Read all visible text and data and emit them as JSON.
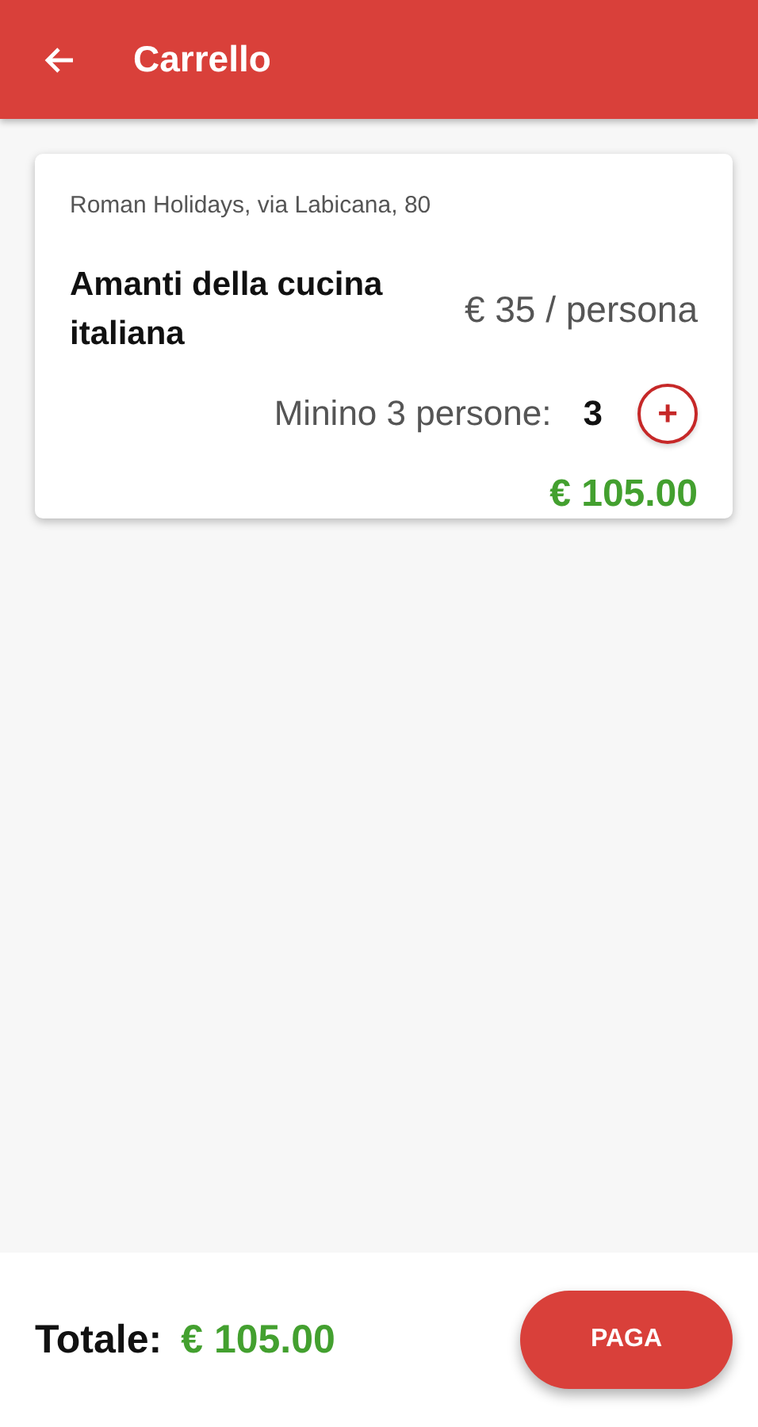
{
  "app_bar": {
    "title": "Carrello"
  },
  "cart_items": [
    {
      "location": "Roman Holidays, via Labicana, 80",
      "name": "Amanti della cucina italiana",
      "price": "€ 35 / persona",
      "quantity_label": "Minino 3 persone:",
      "quantity": "3",
      "add_symbol": "+",
      "subtotal": "€ 105.00"
    }
  ],
  "footer": {
    "total_label": "Totale:",
    "total": "€ 105.00",
    "pay_button": "PAGA"
  }
}
